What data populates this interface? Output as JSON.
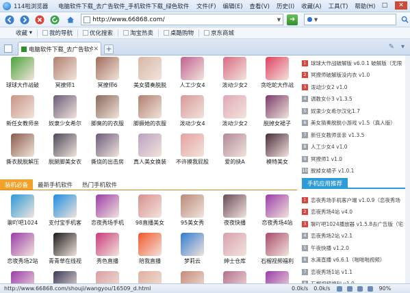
{
  "window": {
    "app_name": "114啦浏览器",
    "page_title": "电脑软件下载_去广告软件_手机软件下载_绿色软件 - ...",
    "menus": [
      "文件(F)",
      "编辑(E)",
      "查看(V)",
      "历史(I)",
      "收藏(A)",
      "工具(T)",
      "帮助(H)"
    ]
  },
  "nav": {
    "url": "http://www.66868.com/",
    "search_placeholder": ""
  },
  "favorites": {
    "collect_label": "收藏",
    "items": [
      "我的导航",
      "优化搜索",
      "淘宝热卖",
      "桌酷购物",
      "京东商城"
    ]
  },
  "tab": {
    "title": "电脑软件下载_去广告软件_..."
  },
  "top_apps": [
    {
      "label": "球球大作战破",
      "color": "#4aa33a"
    },
    {
      "label": "冥撩师1",
      "color": "#b08070"
    },
    {
      "label": "冥撩师6",
      "color": "#a06b5b"
    },
    {
      "label": "美女猜奏脱脱",
      "color": "#d7b7a7"
    },
    {
      "label": "人工少女4",
      "color": "#c06090"
    },
    {
      "label": "泼动少女2",
      "color": "#d86b84"
    },
    {
      "label": "贪吃蛇大作战",
      "color": "#e04060"
    },
    {
      "label": "新任女教师亲",
      "color": "#c99484"
    },
    {
      "label": "奴隶少女希尔",
      "color": "#6a5c7a"
    },
    {
      "label": "脚臭的的衣服",
      "color": "#8a6b5b"
    },
    {
      "label": "脚撅她的衣服",
      "color": "#b07f6e"
    },
    {
      "label": "泼动少女4",
      "color": "#d89898"
    },
    {
      "label": "泼动少女2",
      "color": "#e0a8b8"
    },
    {
      "label": "脱掉女裙子",
      "color": "#7b3a6a"
    },
    {
      "label": "撕衣脱脱解压",
      "color": "#8a5b4b"
    },
    {
      "label": "脱腿脚美女衣",
      "color": "#4a4a5a"
    },
    {
      "label": "撕烧的出击房",
      "color": "#6a5b7b"
    },
    {
      "label": "真人美女换装",
      "color": "#b9a1c1"
    },
    {
      "label": "不许摸我屁股",
      "color": "#e6a0a0"
    },
    {
      "label": "爱的抉A",
      "color": "#b08898"
    },
    {
      "label": "模特美女",
      "color": "#4a2b3b"
    }
  ],
  "right_top_list": [
    {
      "num": "1",
      "text": "球球大作战破解版 v6.0.1 破解版（无限",
      "highlight": true
    },
    {
      "num": "2",
      "text": "冥撩师破解版没内衣 v1.0",
      "highlight": true
    },
    {
      "num": "3",
      "text": "泼动少女2 v1.0",
      "highlight": true
    },
    {
      "num": "4",
      "text": "调教女仆3 v1.3.5",
      "highlight": false
    },
    {
      "num": "5",
      "text": "奴隶少女希尔汉化1.7",
      "highlight": false
    },
    {
      "num": "6",
      "text": "美女猜奏脱脱小游戏 v1.5（真人版）",
      "highlight": false
    },
    {
      "num": "7",
      "text": "新任女教师亲亲 v1.3.5",
      "highlight": false
    },
    {
      "num": "8",
      "text": "人工少女4 v1.0",
      "highlight": false
    },
    {
      "num": "9",
      "text": "冥撩师1 v1.0",
      "highlight": false
    },
    {
      "num": "10",
      "text": "脱掉女裙子 v1.0.1",
      "highlight": false
    }
  ],
  "section_tabs": [
    "装机必备",
    "最新手机软件",
    "热门手机软件"
  ],
  "right_section_title": "手机应用推荐",
  "bottom_apps": [
    {
      "label": "聊吖吧1024",
      "color": "#2a9bd9"
    },
    {
      "label": "支付宝手机客",
      "color": "#1b8ee0"
    },
    {
      "label": "恋夜秀场手机",
      "color": "#9b3ca8"
    },
    {
      "label": "98直播美女",
      "color": "#d89090"
    },
    {
      "label": "95美女秀",
      "color": "#b98a7a"
    },
    {
      "label": "夜夜快播",
      "color": "#6a4b5b"
    },
    {
      "label": "恋夜秀场4站",
      "color": "#9b3ca8"
    },
    {
      "label": "恋夜秀场2站",
      "color": "#9b3ca8"
    },
    {
      "label": "青青草在线视",
      "color": "#1a1a1a"
    },
    {
      "label": "秀色直播",
      "color": "#c93a7a"
    },
    {
      "label": "陪我直播",
      "color": "#f2562a"
    },
    {
      "label": "梦莉云",
      "color": "#2f7bd0"
    },
    {
      "label": "绅士仓库",
      "color": "#d9a0b0"
    },
    {
      "label": "石榴视频福利",
      "color": "#a94b6b"
    },
    {
      "label": "",
      "color": "#9b3ca8"
    },
    {
      "label": "",
      "color": "#3a3a5a"
    },
    {
      "label": "",
      "color": "#d9a0a0"
    },
    {
      "label": "",
      "color": "#e0b0a0"
    },
    {
      "label": "",
      "color": "#c78a7a"
    },
    {
      "label": "",
      "color": "#b56f8f"
    },
    {
      "label": "",
      "color": "#9b3ca8"
    }
  ],
  "right_bottom_list": [
    {
      "num": "1",
      "text": "恋夜秀场手机客户端 v1.0.9（恋夜秀场",
      "highlight": true
    },
    {
      "num": "2",
      "text": "恋夜秀场4站 v4.0",
      "highlight": true
    },
    {
      "num": "3",
      "text": "聊吖吧1024播放器 v1.5.8去广告版（宅",
      "highlight": true
    },
    {
      "num": "4",
      "text": "恋夜秀场2站 v2.1",
      "highlight": false
    },
    {
      "num": "5",
      "text": "午夜快播 v1.2.0",
      "highlight": false
    },
    {
      "num": "6",
      "text": "水滴直播 v6.6.1（啪啪啪视频）",
      "highlight": false
    },
    {
      "num": "7",
      "text": "恋夜秀场1站 v1.1",
      "highlight": false
    },
    {
      "num": "8",
      "text": "石榴视频福利 v1.0",
      "highlight": false
    }
  ],
  "status": {
    "url": "http://www.66868.com/shouji/wangyou/16509_d.html",
    "speed": "0.0k/s",
    "speed2": "0.0k/s",
    "zoom": "90%"
  }
}
